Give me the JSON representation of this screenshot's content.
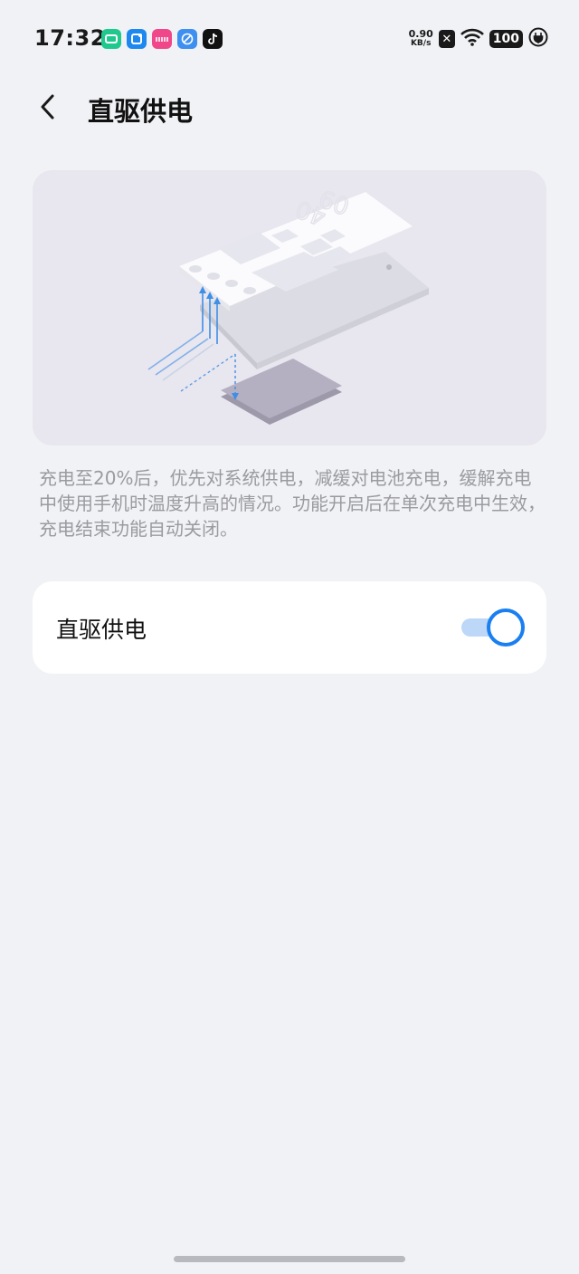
{
  "status_bar": {
    "time": "17:32",
    "net_speed_value": "0.90",
    "net_speed_unit": "KB/s",
    "battery_level": "100",
    "notification_icons": [
      "video-app-icon",
      "message-app-icon",
      "meitu-app-icon",
      "browser-app-icon",
      "tiktok-app-icon"
    ],
    "colors": {
      "video": "#1fc98d",
      "message": "#1d88f0",
      "meitu": "#f0478b",
      "browser": "#3d8ff0",
      "tiktok": "#111111"
    }
  },
  "header": {
    "title": "直驱供电"
  },
  "illustration": {
    "clock_top": "09",
    "clock_bottom": "40"
  },
  "description": "充电至20%后，优先对系统供电，减缓对电池充电，缓解充电中使用手机时温度升高的情况。功能开启后在单次充电中生效，充电结束功能自动关闭。",
  "setting": {
    "label": "直驱供电",
    "enabled": true,
    "accent_color": "#1a7ff0"
  }
}
